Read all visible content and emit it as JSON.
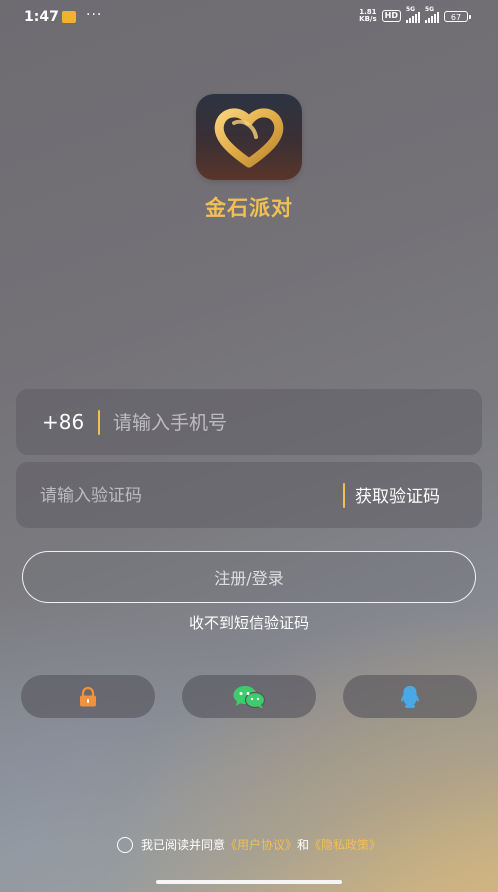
{
  "status_bar": {
    "time": "1:47",
    "net_speed_value": "1.81",
    "net_speed_unit": "KB/s",
    "hd": "HD",
    "signal_1": "5G",
    "signal_2": "5G",
    "battery": "67"
  },
  "app": {
    "name": "金石派对",
    "accent_color": "#f1c052"
  },
  "phone_field": {
    "country_code": "+86",
    "placeholder": "请输入手机号",
    "value": ""
  },
  "code_field": {
    "placeholder": "请输入验证码",
    "value": "",
    "get_code_label": "获取验证码"
  },
  "login_button": {
    "label": "注册/登录"
  },
  "no_code_link": "收不到短信验证码",
  "social_buttons": [
    {
      "icon": "lock-icon",
      "color": "#f0913c"
    },
    {
      "icon": "wechat-icon",
      "color": "#3ecb6b"
    },
    {
      "icon": "qq-icon",
      "color": "#4aa8e6"
    }
  ],
  "agreement": {
    "prefix": "我已阅读并同意",
    "user_agreement": "《用户协议》",
    "conjunction": "和",
    "privacy_policy": "《隐私政策》",
    "checked": false
  }
}
